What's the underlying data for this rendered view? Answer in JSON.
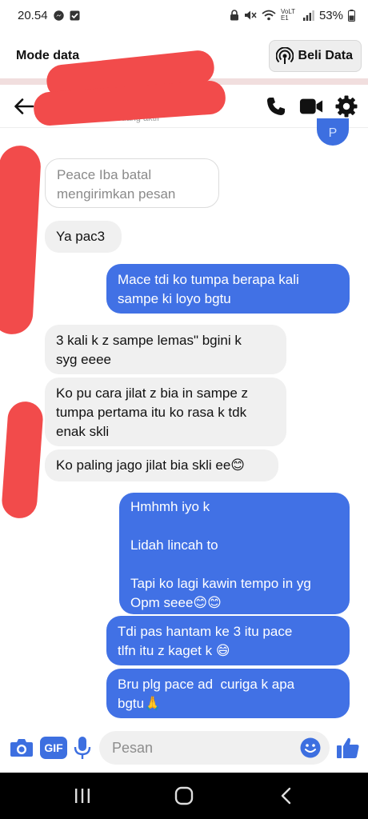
{
  "status_bar": {
    "time": "20.54",
    "network_label": "VoLTE1",
    "battery": "53%",
    "icons": [
      "messenger-icon",
      "checkbox-notification-icon",
      "lock-icon",
      "mute-icon",
      "wifi-icon",
      "signal-icon",
      "battery-icon"
    ]
  },
  "data_bar": {
    "title": "Mode data",
    "buy_label": "Beli Data"
  },
  "header": {
    "contact_status": "Sedang aktif"
  },
  "avatar_letter": "P",
  "messages": [
    {
      "dir": "unsent",
      "lines": [
        "Peace Iba batal",
        "mengirimkan pesan"
      ]
    },
    {
      "dir": "in",
      "lines": [
        "Ya pac3"
      ]
    },
    {
      "dir": "out",
      "lines": [
        "Mace tdi ko tumpa berapa kali",
        "sampe ki loyo bgtu"
      ]
    },
    {
      "dir": "in",
      "lines": [
        "3 kali k z sampe lemas\" bgini k",
        "syg eeee"
      ]
    },
    {
      "dir": "in",
      "lines": [
        "Ko pu cara jilat z bia in sampe z",
        "tumpa pertama itu ko rasa k tdk",
        "enak skli"
      ]
    },
    {
      "dir": "in",
      "lines": [
        "Ko paling jago jilat bia skli ee😊"
      ]
    },
    {
      "dir": "out",
      "lines": [
        "Hmhmh iyo k",
        "",
        "Lidah lincah to",
        "",
        "Tapi ko lagi kawin tempo in yg",
        "Opm seee😊😊"
      ]
    },
    {
      "dir": "out",
      "lines": [
        "Tdi pas hantam ke 3 itu pace",
        "tlfn itu z kaget k 😄"
      ]
    },
    {
      "dir": "out",
      "lines": [
        "Bru plg pace ad  curiga k apa",
        "bgtu🙏"
      ]
    }
  ],
  "composer": {
    "placeholder": "Pesan",
    "gif_label": "GIF"
  },
  "colors": {
    "accent": "#3d6fe0",
    "outgoing_bubble": "#4171e5",
    "incoming_bubble": "#f0f0f0",
    "redaction": "#f24b4b"
  }
}
